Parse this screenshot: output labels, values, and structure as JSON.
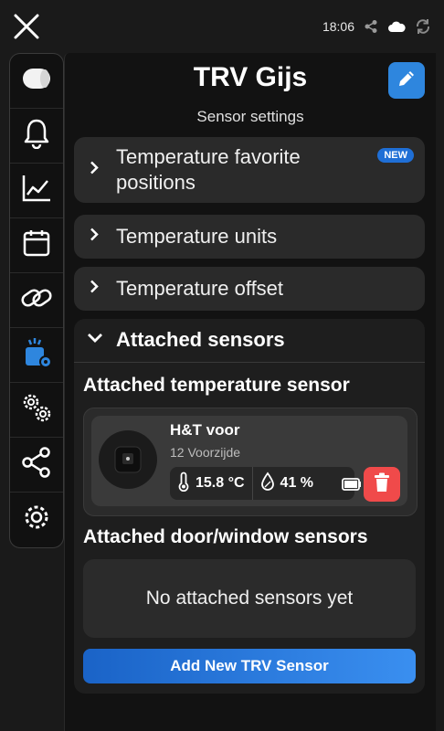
{
  "status_bar": {
    "time": "18:06"
  },
  "sidebar": {
    "items": [
      {
        "name": "device"
      },
      {
        "name": "bell"
      },
      {
        "name": "chart"
      },
      {
        "name": "calendar"
      },
      {
        "name": "link"
      },
      {
        "name": "sensor-settings",
        "active": true
      },
      {
        "name": "gears"
      },
      {
        "name": "share"
      },
      {
        "name": "settings"
      }
    ]
  },
  "header": {
    "title": "TRV Gijs",
    "subtitle": "Sensor settings"
  },
  "sections": [
    {
      "label": "Temperature favorite positions",
      "badge": "NEW"
    },
    {
      "label": "Temperature units"
    },
    {
      "label": "Temperature offset"
    }
  ],
  "attached": {
    "header_label": "Attached sensors",
    "temp_title": "Attached temperature sensor",
    "sensor": {
      "name": "H&T voor",
      "location": "12 Voorzijde",
      "temperature": "15.8 °C",
      "humidity": "41 %"
    },
    "door_title": "Attached door/window sensors",
    "empty_text": "No attached sensors yet",
    "add_button": "Add New TRV Sensor"
  },
  "colors": {
    "accent": "#2e86de",
    "danger": "#f04a4a",
    "badge": "#1f6fd6",
    "active_icon": "#2e86de"
  }
}
